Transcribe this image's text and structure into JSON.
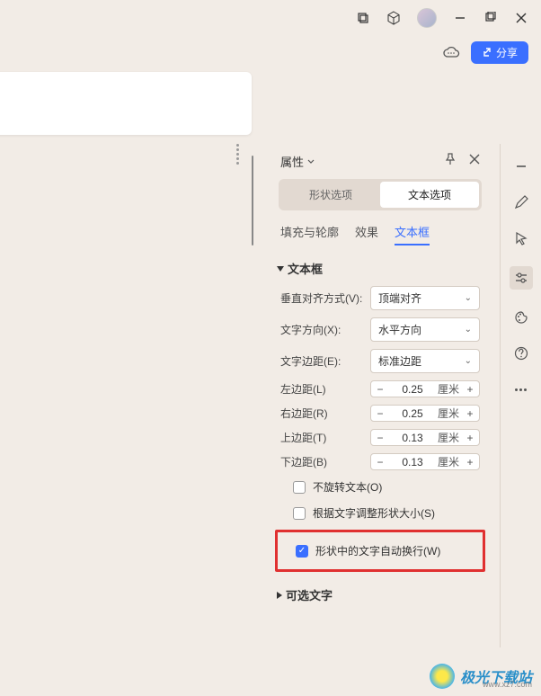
{
  "titlebar": {},
  "share": {
    "label": "分享"
  },
  "panel": {
    "title": "属性",
    "segments": {
      "shape": "形状选项",
      "text": "文本选项"
    },
    "tabs": {
      "fill": "填充与轮廓",
      "effect": "效果",
      "textbox": "文本框"
    },
    "section_textbox": "文本框",
    "rows": {
      "valign": {
        "label": "垂直对齐方式(V):",
        "value": "顶端对齐"
      },
      "textdir": {
        "label": "文字方向(X):",
        "value": "水平方向"
      },
      "margin_mode": {
        "label": "文字边距(E):",
        "value": "标准边距"
      },
      "left": {
        "label": "左边距(L)",
        "value": "0.25",
        "unit": "厘米"
      },
      "right": {
        "label": "右边距(R)",
        "value": "0.25",
        "unit": "厘米"
      },
      "top": {
        "label": "上边距(T)",
        "value": "0.13",
        "unit": "厘米"
      },
      "bottom": {
        "label": "下边距(B)",
        "value": "0.13",
        "unit": "厘米"
      }
    },
    "checks": {
      "no_rotate": "不旋转文本(O)",
      "fit_shape": "根据文字调整形状大小(S)",
      "wrap_text": "形状中的文字自动换行(W)"
    },
    "section_alt": "可选文字"
  },
  "watermark": {
    "text": "极光下载站",
    "sub": "www.xz7.com"
  }
}
